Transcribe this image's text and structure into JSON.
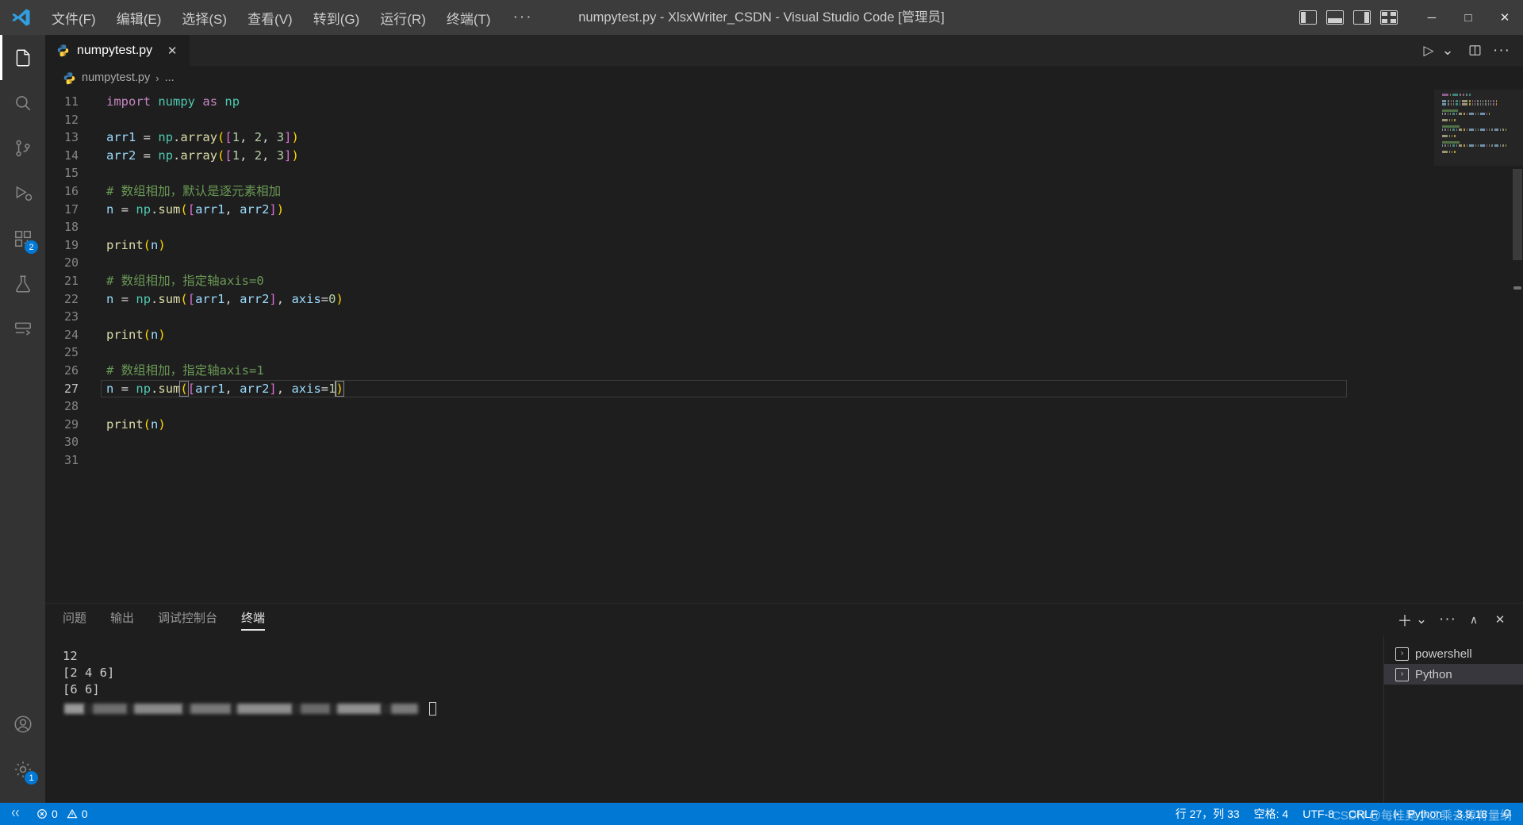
{
  "window": {
    "title": "numpytest.py - XlsxWriter_CSDN - Visual Studio Code [管理员]",
    "minimize": "─",
    "maximize": "□",
    "close": "✕"
  },
  "menu": {
    "items": [
      {
        "label": "文件(F)"
      },
      {
        "label": "编辑(E)"
      },
      {
        "label": "选择(S)"
      },
      {
        "label": "查看(V)"
      },
      {
        "label": "转到(G)"
      },
      {
        "label": "运行(R)"
      },
      {
        "label": "终端(T)"
      },
      {
        "label": "···"
      }
    ]
  },
  "activitybar": {
    "items": [
      {
        "name": "explorer",
        "icon": "files-icon",
        "badge": ""
      },
      {
        "name": "search",
        "icon": "search-icon",
        "badge": ""
      },
      {
        "name": "source-control",
        "icon": "source-control-icon",
        "badge": ""
      },
      {
        "name": "run-and-debug",
        "icon": "run-debug-icon",
        "badge": ""
      },
      {
        "name": "extensions",
        "icon": "extensions-icon",
        "badge": "2"
      },
      {
        "name": "testing",
        "icon": "beaker-icon",
        "badge": ""
      },
      {
        "name": "remote-explorer",
        "icon": "remote-icon",
        "badge": ""
      }
    ],
    "bottom": [
      {
        "name": "accounts",
        "icon": "account-icon",
        "badge": ""
      },
      {
        "name": "settings",
        "icon": "gear-icon",
        "badge": "1"
      }
    ]
  },
  "tabs": [
    {
      "label": "numpytest.py",
      "icon": "python-icon",
      "close": "✕",
      "active": true
    }
  ],
  "editor_actions": {
    "run": "▷",
    "run_chevron": "⌄",
    "split": "split-editor-icon",
    "more": "···"
  },
  "breadcrumb": {
    "file": "numpytest.py",
    "separator": "›",
    "tail": "..."
  },
  "code": {
    "first_line": 11,
    "current_line": 27,
    "lines": [
      {
        "n": 11,
        "tokens": [
          {
            "t": "import",
            "c": "kw"
          },
          {
            "t": " ",
            "c": "plain"
          },
          {
            "t": "numpy",
            "c": "mod"
          },
          {
            "t": " ",
            "c": "plain"
          },
          {
            "t": "as",
            "c": "kw"
          },
          {
            "t": " ",
            "c": "plain"
          },
          {
            "t": "np",
            "c": "mod"
          }
        ]
      },
      {
        "n": 12,
        "tokens": []
      },
      {
        "n": 13,
        "tokens": [
          {
            "t": "arr1",
            "c": "var"
          },
          {
            "t": " ",
            "c": "plain"
          },
          {
            "t": "=",
            "c": "op"
          },
          {
            "t": " ",
            "c": "plain"
          },
          {
            "t": "np",
            "c": "mod"
          },
          {
            "t": ".",
            "c": "op"
          },
          {
            "t": "array",
            "c": "fn"
          },
          {
            "t": "(",
            "c": "p1"
          },
          {
            "t": "[",
            "c": "p2"
          },
          {
            "t": "1",
            "c": "num"
          },
          {
            "t": ",",
            "c": "op"
          },
          {
            "t": " ",
            "c": "plain"
          },
          {
            "t": "2",
            "c": "num"
          },
          {
            "t": ",",
            "c": "op"
          },
          {
            "t": " ",
            "c": "plain"
          },
          {
            "t": "3",
            "c": "num"
          },
          {
            "t": "]",
            "c": "p2"
          },
          {
            "t": ")",
            "c": "p1"
          }
        ]
      },
      {
        "n": 14,
        "tokens": [
          {
            "t": "arr2",
            "c": "var"
          },
          {
            "t": " ",
            "c": "plain"
          },
          {
            "t": "=",
            "c": "op"
          },
          {
            "t": " ",
            "c": "plain"
          },
          {
            "t": "np",
            "c": "mod"
          },
          {
            "t": ".",
            "c": "op"
          },
          {
            "t": "array",
            "c": "fn"
          },
          {
            "t": "(",
            "c": "p1"
          },
          {
            "t": "[",
            "c": "p2"
          },
          {
            "t": "1",
            "c": "num"
          },
          {
            "t": ",",
            "c": "op"
          },
          {
            "t": " ",
            "c": "plain"
          },
          {
            "t": "2",
            "c": "num"
          },
          {
            "t": ",",
            "c": "op"
          },
          {
            "t": " ",
            "c": "plain"
          },
          {
            "t": "3",
            "c": "num"
          },
          {
            "t": "]",
            "c": "p2"
          },
          {
            "t": ")",
            "c": "p1"
          }
        ]
      },
      {
        "n": 15,
        "tokens": []
      },
      {
        "n": 16,
        "tokens": [
          {
            "t": "# 数组相加，默认是逐元素相加",
            "c": "cmt"
          }
        ]
      },
      {
        "n": 17,
        "tokens": [
          {
            "t": "n",
            "c": "var"
          },
          {
            "t": " ",
            "c": "plain"
          },
          {
            "t": "=",
            "c": "op"
          },
          {
            "t": " ",
            "c": "plain"
          },
          {
            "t": "np",
            "c": "mod"
          },
          {
            "t": ".",
            "c": "op"
          },
          {
            "t": "sum",
            "c": "fn"
          },
          {
            "t": "(",
            "c": "p1"
          },
          {
            "t": "[",
            "c": "p2"
          },
          {
            "t": "arr1",
            "c": "var"
          },
          {
            "t": ",",
            "c": "op"
          },
          {
            "t": " ",
            "c": "plain"
          },
          {
            "t": "arr2",
            "c": "var"
          },
          {
            "t": "]",
            "c": "p2"
          },
          {
            "t": ")",
            "c": "p1"
          }
        ]
      },
      {
        "n": 18,
        "tokens": []
      },
      {
        "n": 19,
        "tokens": [
          {
            "t": "print",
            "c": "fn"
          },
          {
            "t": "(",
            "c": "p1"
          },
          {
            "t": "n",
            "c": "var"
          },
          {
            "t": ")",
            "c": "p1"
          }
        ]
      },
      {
        "n": 20,
        "tokens": []
      },
      {
        "n": 21,
        "tokens": [
          {
            "t": "# 数组相加，指定轴axis=0",
            "c": "cmt"
          }
        ]
      },
      {
        "n": 22,
        "tokens": [
          {
            "t": "n",
            "c": "var"
          },
          {
            "t": " ",
            "c": "plain"
          },
          {
            "t": "=",
            "c": "op"
          },
          {
            "t": " ",
            "c": "plain"
          },
          {
            "t": "np",
            "c": "mod"
          },
          {
            "t": ".",
            "c": "op"
          },
          {
            "t": "sum",
            "c": "fn"
          },
          {
            "t": "(",
            "c": "p1"
          },
          {
            "t": "[",
            "c": "p2"
          },
          {
            "t": "arr1",
            "c": "var"
          },
          {
            "t": ",",
            "c": "op"
          },
          {
            "t": " ",
            "c": "plain"
          },
          {
            "t": "arr2",
            "c": "var"
          },
          {
            "t": "]",
            "c": "p2"
          },
          {
            "t": ",",
            "c": "op"
          },
          {
            "t": " ",
            "c": "plain"
          },
          {
            "t": "axis",
            "c": "var"
          },
          {
            "t": "=",
            "c": "op"
          },
          {
            "t": "0",
            "c": "num"
          },
          {
            "t": ")",
            "c": "p1"
          }
        ]
      },
      {
        "n": 23,
        "tokens": []
      },
      {
        "n": 24,
        "tokens": [
          {
            "t": "print",
            "c": "fn"
          },
          {
            "t": "(",
            "c": "p1"
          },
          {
            "t": "n",
            "c": "var"
          },
          {
            "t": ")",
            "c": "p1"
          }
        ]
      },
      {
        "n": 25,
        "tokens": []
      },
      {
        "n": 26,
        "tokens": [
          {
            "t": "# 数组相加，指定轴axis=1",
            "c": "cmt"
          }
        ]
      },
      {
        "n": 27,
        "tokens": [
          {
            "t": "n",
            "c": "var"
          },
          {
            "t": " ",
            "c": "plain"
          },
          {
            "t": "=",
            "c": "op"
          },
          {
            "t": " ",
            "c": "plain"
          },
          {
            "t": "np",
            "c": "mod"
          },
          {
            "t": ".",
            "c": "op"
          },
          {
            "t": "sum",
            "c": "fn"
          },
          {
            "t": "(",
            "c": "p1 bracket-match"
          },
          {
            "t": "[",
            "c": "p2"
          },
          {
            "t": "arr1",
            "c": "var"
          },
          {
            "t": ",",
            "c": "op"
          },
          {
            "t": " ",
            "c": "plain"
          },
          {
            "t": "arr2",
            "c": "var"
          },
          {
            "t": "]",
            "c": "p2"
          },
          {
            "t": ",",
            "c": "op"
          },
          {
            "t": " ",
            "c": "plain"
          },
          {
            "t": "axis",
            "c": "var"
          },
          {
            "t": "=",
            "c": "op"
          },
          {
            "t": "1",
            "c": "num"
          },
          {
            "t": "|CURSOR|",
            "c": "cursor"
          },
          {
            "t": ")",
            "c": "p1 bracket-match"
          }
        ]
      },
      {
        "n": 28,
        "tokens": []
      },
      {
        "n": 29,
        "tokens": [
          {
            "t": "print",
            "c": "fn"
          },
          {
            "t": "(",
            "c": "p1"
          },
          {
            "t": "n",
            "c": "var"
          },
          {
            "t": ")",
            "c": "p1"
          }
        ]
      },
      {
        "n": 30,
        "tokens": []
      },
      {
        "n": 31,
        "tokens": []
      }
    ]
  },
  "panel": {
    "tabs": [
      {
        "label": "问题",
        "active": false
      },
      {
        "label": "输出",
        "active": false
      },
      {
        "label": "调试控制台",
        "active": false
      },
      {
        "label": "终端",
        "active": true
      }
    ],
    "actions": {
      "new_terminal": "＋",
      "new_chevron": "⌄",
      "more": "···",
      "maximize": "∧",
      "close": "✕"
    },
    "terminal_output": [
      "12",
      "[2 4 6]",
      "[6 6]"
    ],
    "terminal_prompt_redacted": true,
    "terminal_list": [
      {
        "label": "powershell",
        "icon": "terminal-icon",
        "active": false
      },
      {
        "label": "Python",
        "icon": "terminal-icon",
        "active": true
      }
    ]
  },
  "statusbar": {
    "errors_icon": "error-icon",
    "errors": "0",
    "warnings_icon": "warning-icon",
    "warnings": "0",
    "cursor_position": "行 27，列 33",
    "indentation": "空格: 4",
    "encoding": "UTF-8",
    "eol": "CRLF",
    "language_icon": "python-brackets-icon",
    "language": "Python",
    "interpreter_version": "3.9.18",
    "bell_icon": "bell-icon",
    "accent_color": "#0078d4"
  },
  "watermark": "CSDN @每桂昊小二乘去掉有量纲"
}
